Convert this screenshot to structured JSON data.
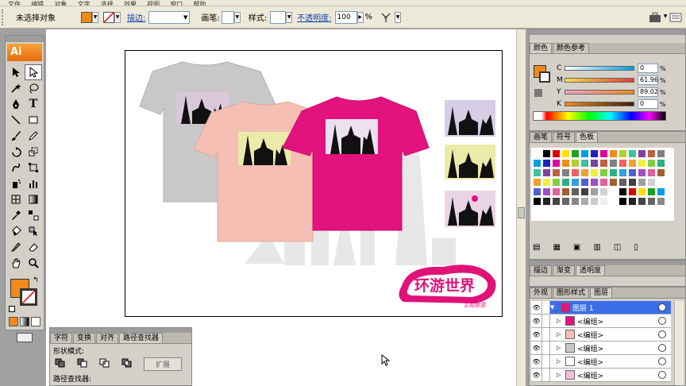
{
  "menubar": {
    "items": [
      "文件",
      "编辑",
      "对象",
      "文字",
      "选择",
      "效果",
      "视图",
      "窗口",
      "帮助"
    ]
  },
  "control_bar": {
    "selection_label": "未选择对象",
    "stroke_label": "描边:",
    "brush_label": "画笔:",
    "style_label": "样式:",
    "opacity_label": "不透明度:",
    "opacity_value": "100",
    "opacity_unit": "%",
    "fill_color": "#f08a1a"
  },
  "toolbox": {
    "logo": "Ai"
  },
  "color_panel": {
    "tabs": [
      "颜色",
      "颜色参考"
    ],
    "channels": [
      {
        "name": "C",
        "value": "0",
        "unit": "%"
      },
      {
        "name": "M",
        "value": "61.96",
        "unit": "%"
      },
      {
        "name": "Y",
        "value": "89.02",
        "unit": "%"
      },
      {
        "name": "K",
        "value": "0",
        "unit": "%"
      }
    ],
    "fill": "#f08a1a"
  },
  "swatch_panel": {
    "tabs": [
      "画笔",
      "符号",
      "色板"
    ]
  },
  "transparency_panel": {
    "tabs": [
      "描边",
      "渐变",
      "透明度"
    ]
  },
  "layers_panel": {
    "tabs": [
      "外观",
      "图形样式",
      "图层"
    ],
    "rows": [
      {
        "name": "图层 1",
        "highlight": true
      },
      {
        "name": "<编组>",
        "highlight": false
      },
      {
        "name": "<编组>",
        "highlight": false
      },
      {
        "name": "<编组>",
        "highlight": false
      },
      {
        "name": "<编组>",
        "highlight": false
      },
      {
        "name": "<编组>",
        "highlight": false
      }
    ]
  },
  "pathfinder_panel": {
    "tabs": [
      "字符",
      "变换",
      "对齐",
      "路径查找器"
    ],
    "shape_modes_label": "形状模式:",
    "expand_label": "扩展",
    "pathfinders_label": "路径查找器:"
  },
  "artwork": {
    "logo_text": "环游世界",
    "logo_sub": "主题旅游",
    "shirt_colors": [
      "#c8c8c8",
      "#f5bfb4",
      "#e2127e"
    ],
    "logo_color": "#e0127a"
  }
}
